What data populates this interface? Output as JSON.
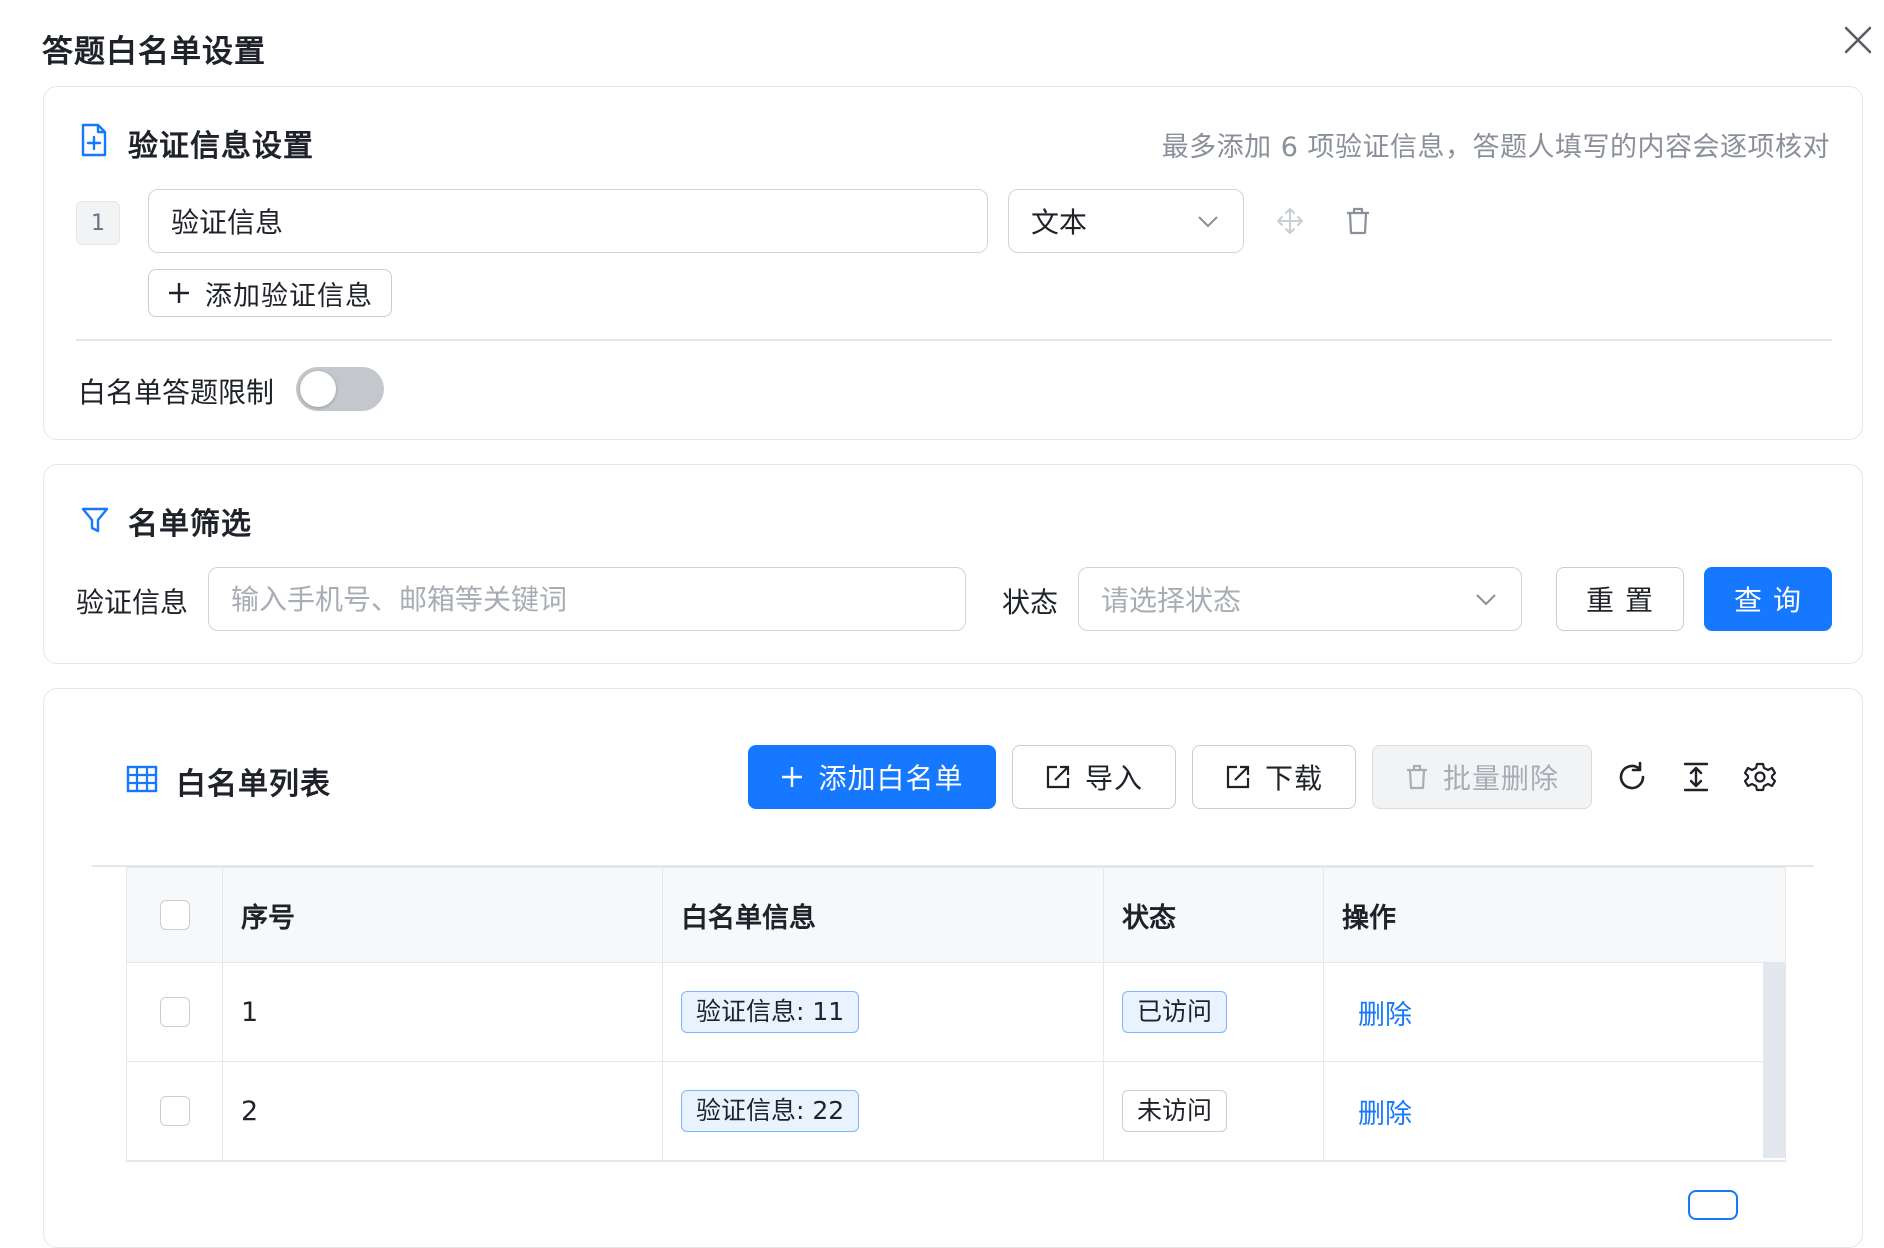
{
  "dialog": {
    "title": "答题白名单设置"
  },
  "verify_settings": {
    "title": "验证信息设置",
    "hint": "最多添加 6 项验证信息，答题人填写的内容会逐项核对",
    "items": [
      {
        "index": "1",
        "name_value": "验证信息",
        "type_value": "文本"
      }
    ],
    "add_label": "添加验证信息",
    "limit_label": "白名单答题限制",
    "limit_enabled": false
  },
  "filter": {
    "title": "名单筛选",
    "verify_label": "验证信息",
    "verify_placeholder": "输入手机号、邮箱等关键词",
    "status_label": "状态",
    "status_placeholder": "请选择状态",
    "reset_label": "重 置",
    "query_label": "查 询"
  },
  "list": {
    "title": "白名单列表",
    "add_label": "添加白名单",
    "import_label": "导入",
    "download_label": "下载",
    "batch_delete_label": "批量删除",
    "columns": [
      "序号",
      "白名单信息",
      "状态",
      "操作"
    ],
    "rows": [
      {
        "index": "1",
        "info": "验证信息: 11",
        "status": "已访问",
        "status_type": "visited",
        "action": "删除"
      },
      {
        "index": "2",
        "info": "验证信息: 22",
        "status": "未访问",
        "status_type": "unvisited",
        "action": "删除"
      }
    ]
  },
  "colors": {
    "primary": "#1677ff",
    "border": "#e5e7eb",
    "tag_blue_bg": "#e8f3ff"
  }
}
